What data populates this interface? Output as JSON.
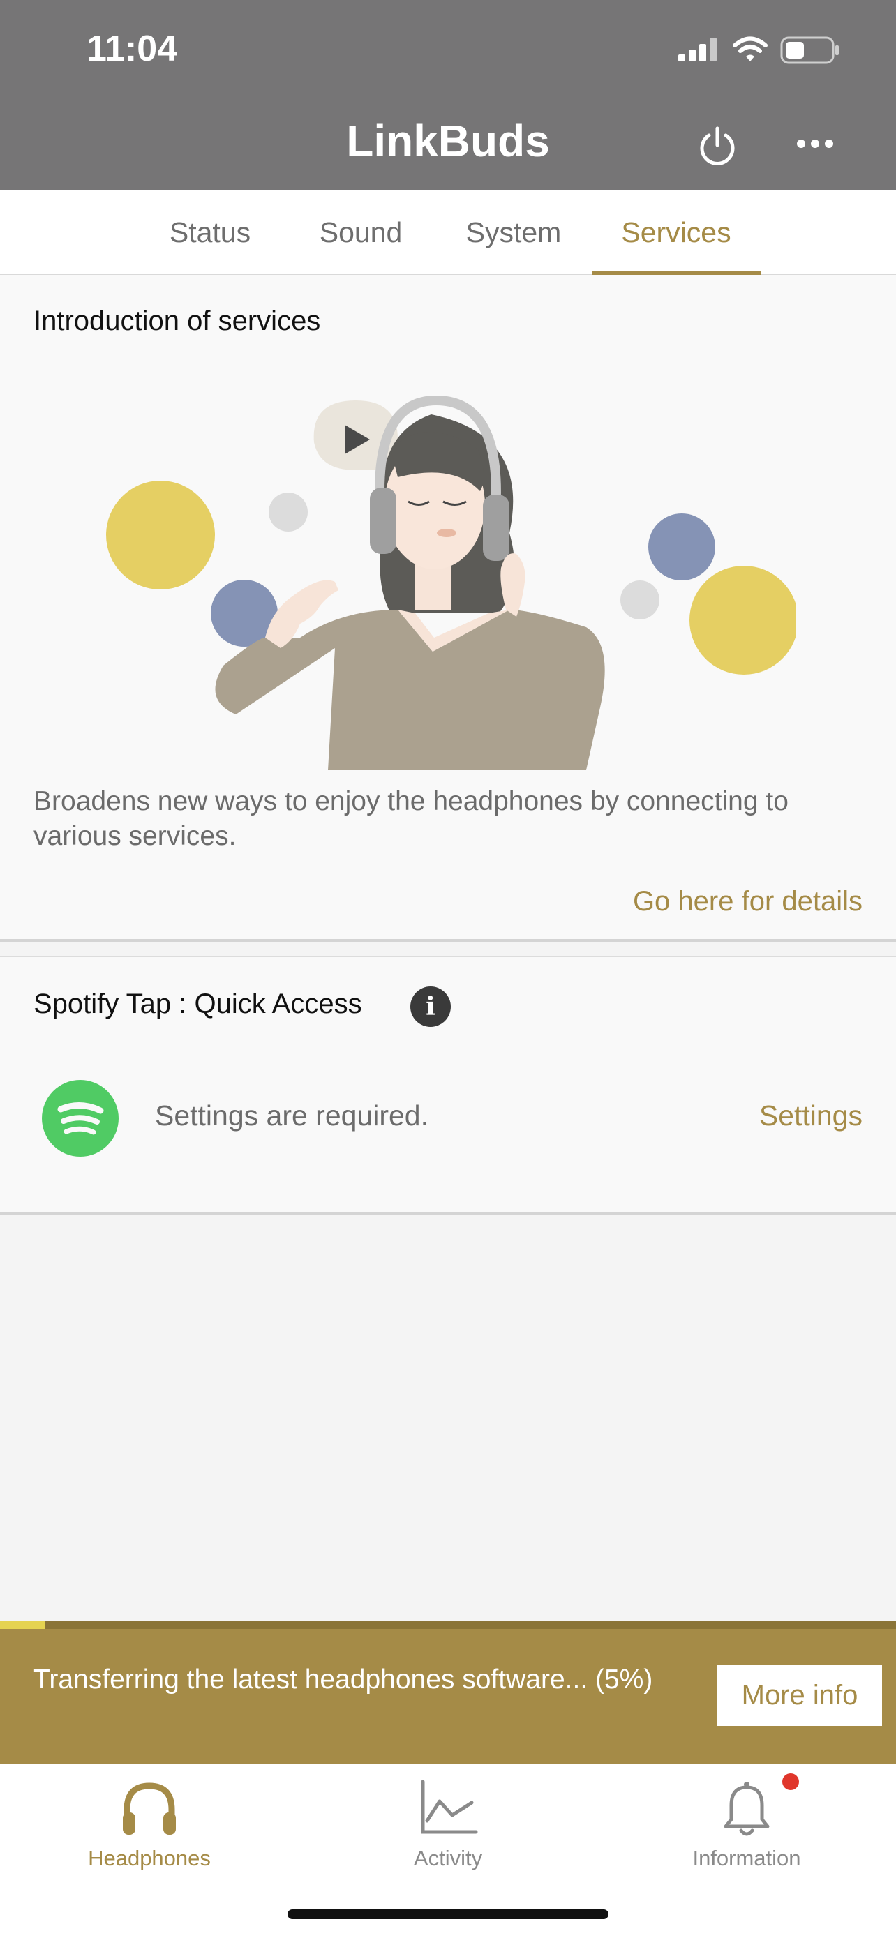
{
  "status_bar": {
    "time": "11:04"
  },
  "header": {
    "title": "LinkBuds",
    "power_icon": "power-icon",
    "more_icon": "more-icon"
  },
  "tabs": [
    {
      "label": "Status",
      "active": false
    },
    {
      "label": "Sound",
      "active": false
    },
    {
      "label": "System",
      "active": false
    },
    {
      "label": "Services",
      "active": true
    }
  ],
  "intro": {
    "title": "Introduction of services",
    "description": "Broadens new ways to enjoy the headphones by connecting to various services.",
    "link": "Go here for details"
  },
  "spotify": {
    "title": "Spotify Tap : Quick Access",
    "status": "Settings are required.",
    "action": "Settings",
    "logo_color": "#50cb64"
  },
  "transfer": {
    "message": "Transferring the latest headphones software... (5%)",
    "progress_percent": 5,
    "button": "More info"
  },
  "bottom_nav": [
    {
      "label": "Headphones",
      "icon": "headphones-icon",
      "active": true
    },
    {
      "label": "Activity",
      "icon": "activity-chart-icon",
      "active": false
    },
    {
      "label": "Information",
      "icon": "bell-icon",
      "active": false,
      "badge": true
    }
  ],
  "colors": {
    "accent": "#a58b47",
    "header": "#767576",
    "badge": "#e0362b"
  }
}
